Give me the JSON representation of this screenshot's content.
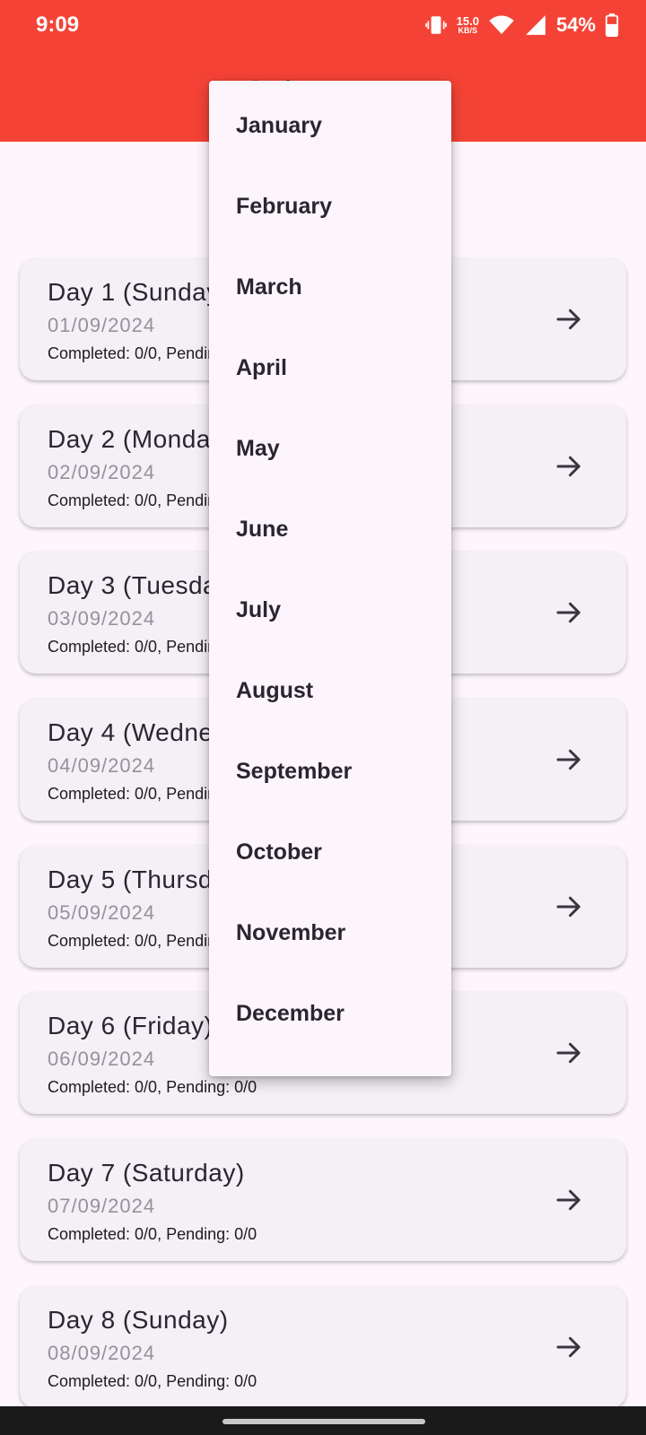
{
  "status_bar": {
    "time": "9:09",
    "net_speed_value": "15.0",
    "net_speed_unit": "KB/S",
    "battery_percent": "54%",
    "icons": [
      "vibrate-icon",
      "wifi-icon",
      "cellular-signal-icon",
      "battery-icon"
    ]
  },
  "appbar": {
    "title": "Select Day",
    "color": "#f44336"
  },
  "days": [
    {
      "title": "Day 1 (Sunday)",
      "date": "01/09/2024",
      "status": "Completed: 0/0, Pending: 0/0"
    },
    {
      "title": "Day 2 (Monday)",
      "date": "02/09/2024",
      "status": "Completed: 0/0, Pending: 0/0"
    },
    {
      "title": "Day 3 (Tuesday)",
      "date": "03/09/2024",
      "status": "Completed: 0/0, Pending: 0/0"
    },
    {
      "title": "Day 4 (Wednesday)",
      "date": "04/09/2024",
      "status": "Completed: 0/0, Pending: 0/0"
    },
    {
      "title": "Day 5 (Thursday)",
      "date": "05/09/2024",
      "status": "Completed: 0/0, Pending: 0/0"
    },
    {
      "title": "Day 6 (Friday)",
      "date": "06/09/2024",
      "status": "Completed: 0/0, Pending: 0/0"
    },
    {
      "title": "Day 7 (Saturday)",
      "date": "07/09/2024",
      "status": "Completed: 0/0, Pending: 0/0"
    },
    {
      "title": "Day 8 (Sunday)",
      "date": "08/09/2024",
      "status": "Completed: 0/0, Pending: 0/0"
    }
  ],
  "month_menu": {
    "items": [
      "January",
      "February",
      "March",
      "April",
      "May",
      "June",
      "July",
      "August",
      "September",
      "October",
      "November",
      "December"
    ]
  }
}
